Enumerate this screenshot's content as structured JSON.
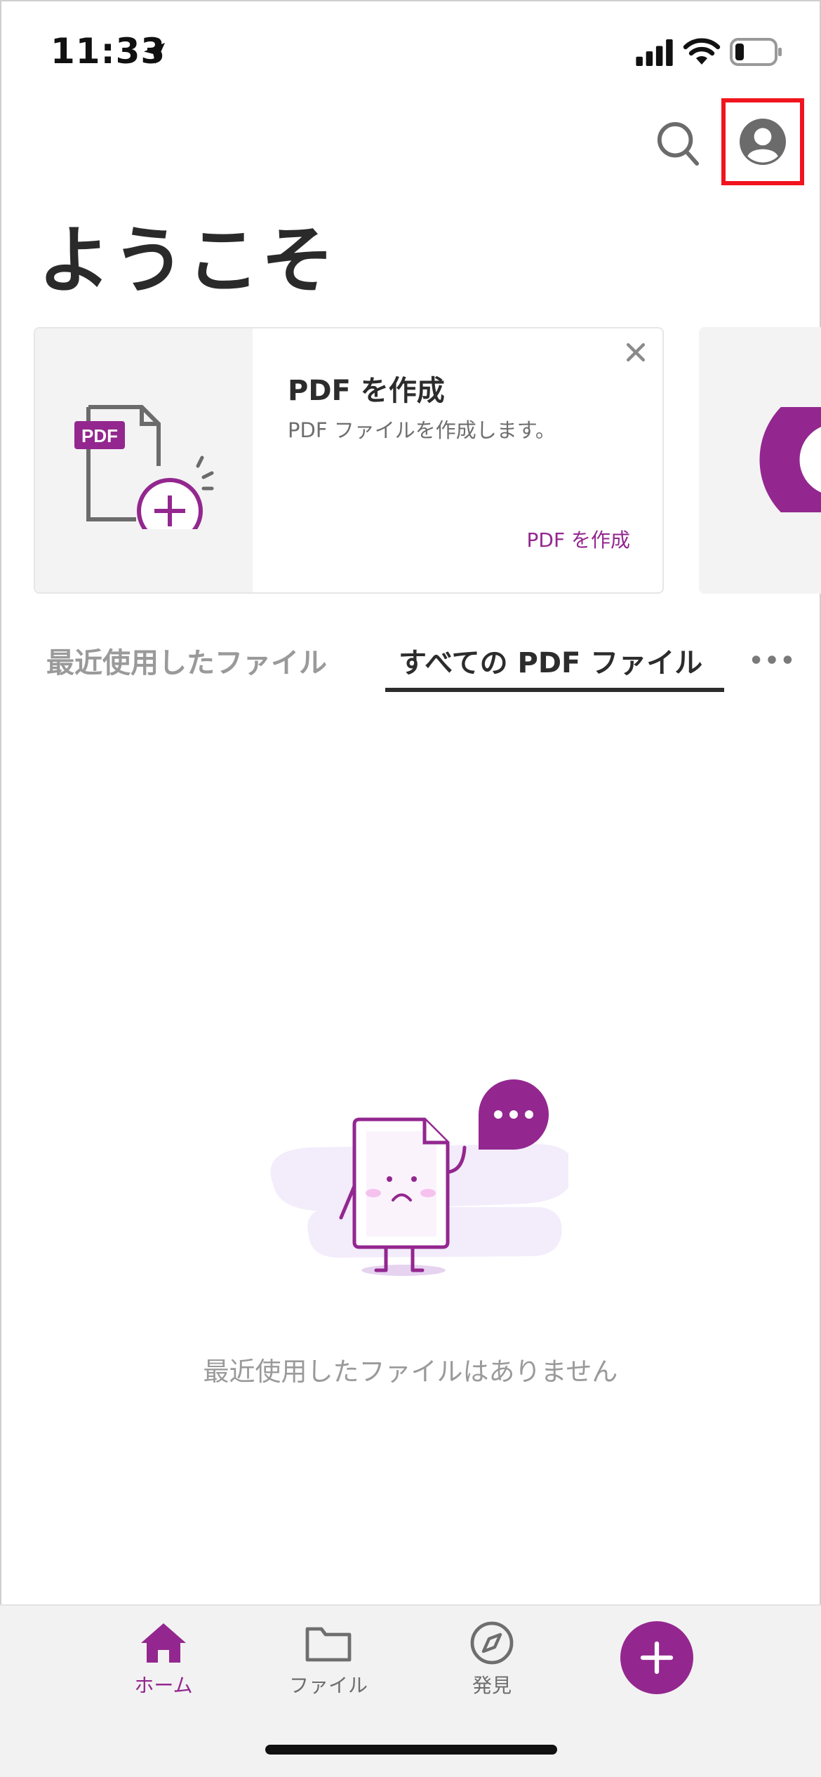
{
  "status_bar": {
    "time": "11:33"
  },
  "header": {
    "title": "ようこそ"
  },
  "promo": {
    "title": "PDF を作成",
    "description": "PDF ファイルを作成します。",
    "link": "PDF を作成",
    "badge": "PDF"
  },
  "tabs": [
    {
      "label": "最近使用したファイル",
      "active": false
    },
    {
      "label": "すべての PDF ファイル",
      "active": true
    }
  ],
  "empty_state": {
    "message": "最近使用したファイルはありません"
  },
  "bottom_nav": {
    "items": [
      {
        "label": "ホーム",
        "icon": "home-icon",
        "active": true
      },
      {
        "label": "ファイル",
        "icon": "folder-icon",
        "active": false
      },
      {
        "label": "発見",
        "icon": "compass-icon",
        "active": false
      }
    ],
    "fab_icon": "plus-icon"
  },
  "colors": {
    "accent": "#93278f",
    "highlight_box": "#f0141e",
    "text_primary": "#2c2c2c",
    "text_muted": "#9a9a9a"
  }
}
